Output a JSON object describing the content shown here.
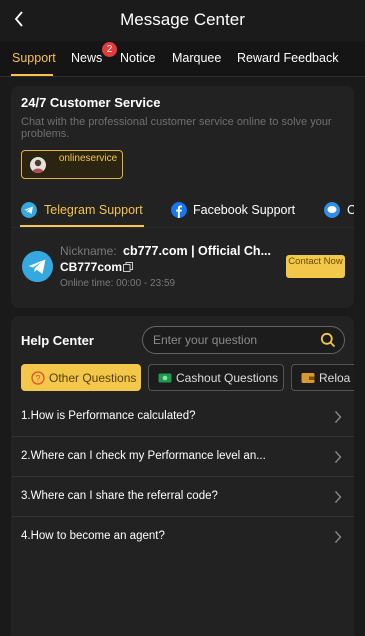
{
  "header": {
    "title": "Message Center",
    "back_icon": "chevron-left-icon"
  },
  "tabs": [
    {
      "label": "Support",
      "active": true
    },
    {
      "label": "News",
      "badge": "2"
    },
    {
      "label": "Notice"
    },
    {
      "label": "Marquee"
    },
    {
      "label": "Reward Feedback"
    }
  ],
  "customer_service": {
    "title": "24/7 Customer Service",
    "description": "Chat with the professional customer service online to solve your problems.",
    "chip_label": "onlineservice"
  },
  "channels": [
    {
      "label": "Telegram Support",
      "icon": "telegram-icon",
      "active": true
    },
    {
      "label": "Facebook Support",
      "icon": "facebook-icon"
    },
    {
      "label": "C",
      "icon": "chat-icon"
    }
  ],
  "contact": {
    "nickname_label": "Nickname:",
    "nickname_value": "cb777.com | Official Ch...",
    "handle": "CB777com",
    "online_time": "Online time: 00:00 - 23:59",
    "button_label": "Contact Now"
  },
  "help": {
    "title": "Help Center",
    "search_placeholder": "Enter your question",
    "categories": [
      {
        "label": "Other Questions",
        "icon": "question-circle-icon",
        "active": true
      },
      {
        "label": "Cashout Questions",
        "icon": "cash-icon"
      },
      {
        "label": "Reloa",
        "icon": "wallet-icon"
      }
    ],
    "faqs": [
      "1.How is Performance calculated?",
      "2.Where can I check my Performance level an...",
      "3.Where can I share the referral code?",
      "4.How to become an agent?"
    ]
  },
  "colors": {
    "accent": "#f7c34d",
    "badge": "#e33b3b",
    "background": "#1a1a1a",
    "card": "#222222"
  }
}
